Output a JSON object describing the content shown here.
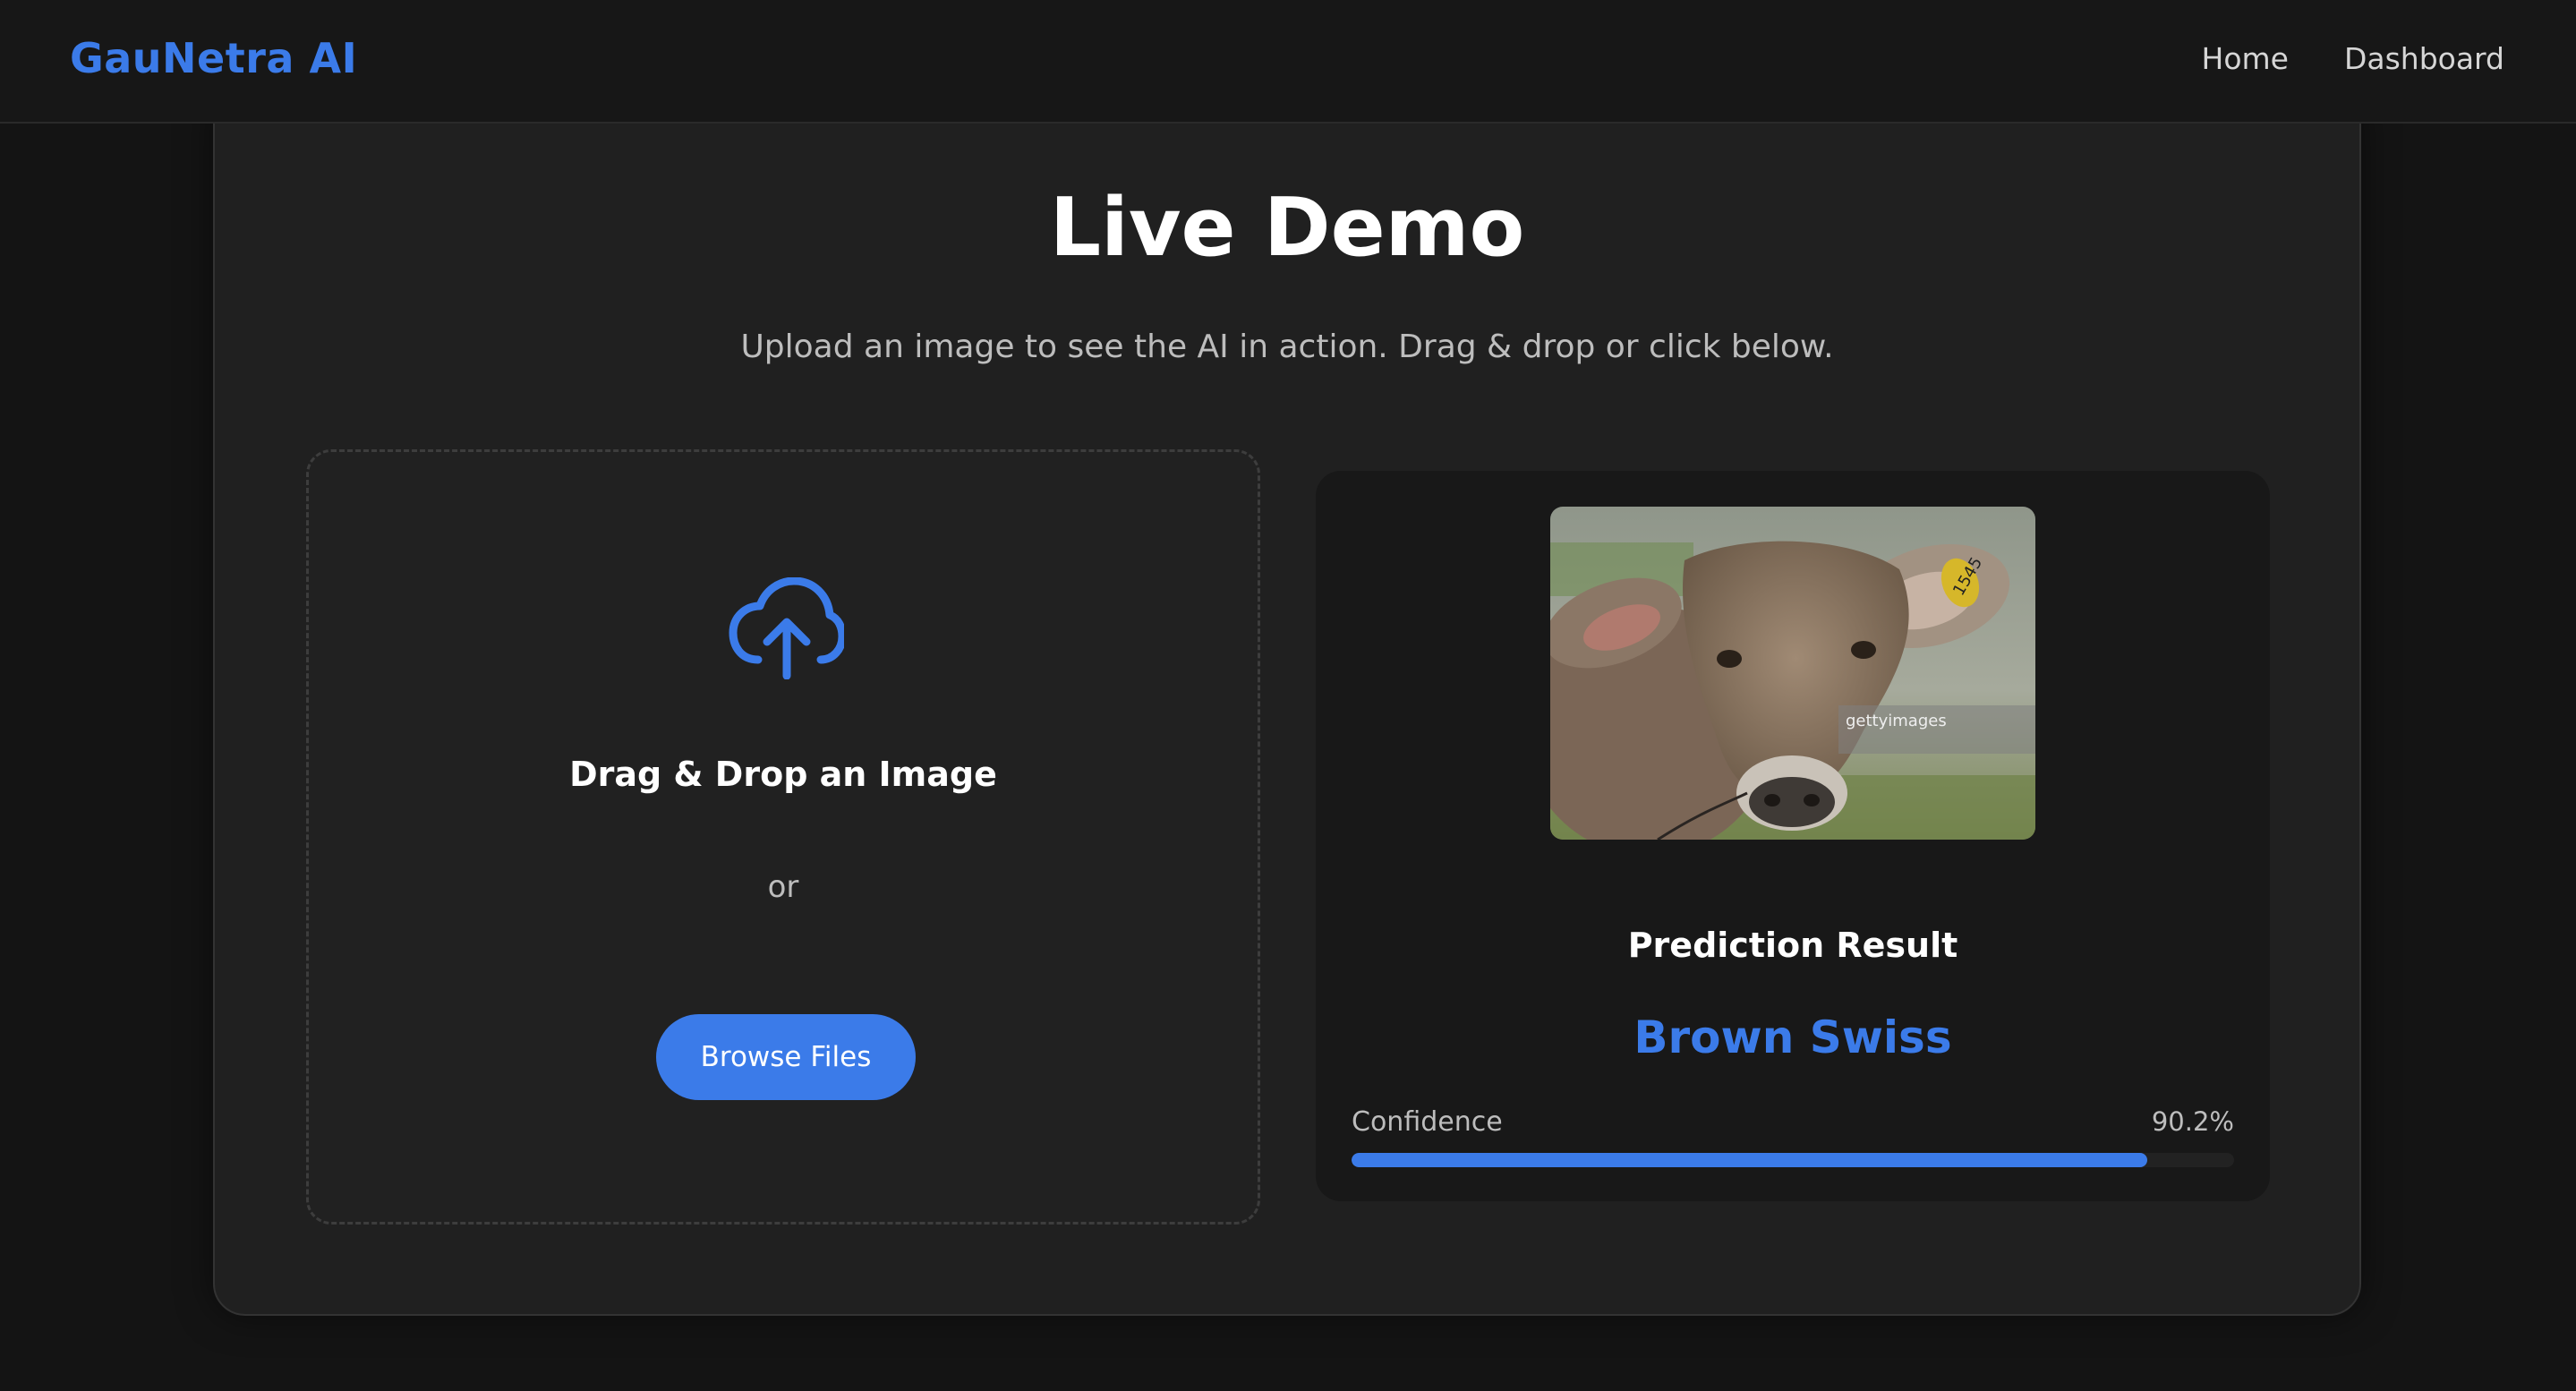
{
  "nav": {
    "brand": "GauNetra AI",
    "links": [
      "Home",
      "Dashboard"
    ]
  },
  "demo": {
    "title": "Live Demo",
    "subtitle": "Upload an image to see the AI in action. Drag & drop or click below."
  },
  "upload": {
    "heading": "Drag & Drop an Image",
    "or_text": "or",
    "browse_label": "Browse Files",
    "icon": "cloud-upload-icon"
  },
  "result": {
    "image_alt": "cow photo",
    "watermark": "gettyimages",
    "tag_number": "1545",
    "heading": "Prediction Result",
    "label": "Brown Swiss",
    "confidence_label": "Confidence",
    "confidence_text": "90.2%",
    "confidence_value": 0.902
  },
  "colors": {
    "accent": "#3b7be9",
    "background": "#141414",
    "card": "#202020"
  }
}
